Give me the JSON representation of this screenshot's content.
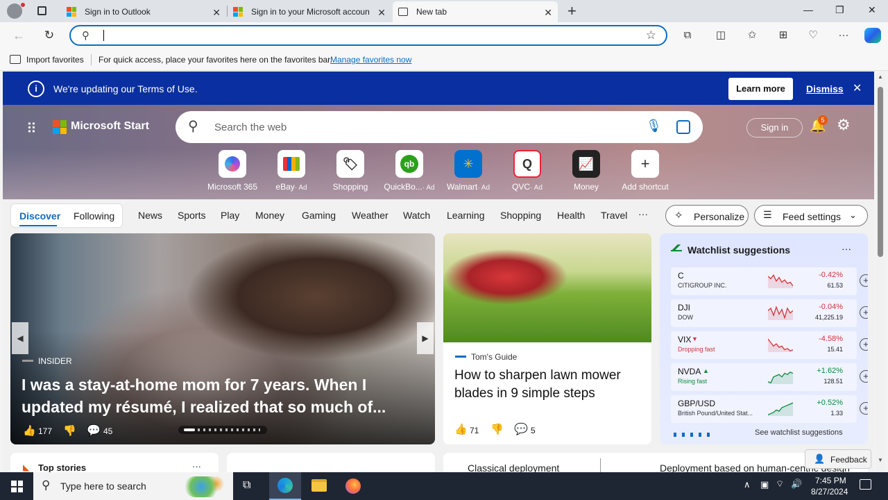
{
  "browser": {
    "tabs": [
      {
        "title": "Sign in to Outlook"
      },
      {
        "title": "Sign in to your Microsoft accoun"
      },
      {
        "title": "New tab"
      }
    ],
    "favorites_bar": {
      "import_label": "Import favorites",
      "hint": "For quick access, place your favorites here on the favorites bar.",
      "manage_link": "Manage favorites now"
    }
  },
  "banner": {
    "message": "We're updating our Terms of Use.",
    "learn_more": "Learn more",
    "dismiss": "Dismiss"
  },
  "header": {
    "brand": "Microsoft Start",
    "search_placeholder": "Search the web",
    "sign_in": "Sign in",
    "notification_count": "5"
  },
  "shortcuts": [
    {
      "label": "Microsoft 365",
      "ad": ""
    },
    {
      "label": "eBay",
      "ad": "· Ad"
    },
    {
      "label": "Shopping",
      "ad": ""
    },
    {
      "label": "QuickBo...",
      "ad": "· Ad"
    },
    {
      "label": "Walmart",
      "ad": "· Ad"
    },
    {
      "label": "QVC",
      "ad": "· Ad"
    },
    {
      "label": "Money",
      "ad": ""
    },
    {
      "label": "Add shortcut",
      "ad": ""
    }
  ],
  "nav": {
    "discover": "Discover",
    "following": "Following",
    "items": [
      "News",
      "Sports",
      "Play",
      "Money",
      "Gaming",
      "Weather",
      "Watch",
      "Learning",
      "Shopping",
      "Health",
      "Travel"
    ],
    "more": "···",
    "personalize": "Personalize",
    "feed_settings": "Feed settings"
  },
  "hero_article": {
    "source": "INSIDER",
    "title": "I was a stay-at-home mom for 7 years. When I updated my résumé, I realized that so much of...",
    "likes": "177",
    "comments": "45"
  },
  "side_article": {
    "source": "Tom's Guide",
    "title": "How to sharpen lawn mower blades in 9 simple steps",
    "likes": "71",
    "comments": "5"
  },
  "watchlist": {
    "title": "Watchlist suggestions",
    "more": "···",
    "items": [
      {
        "symbol": "C",
        "name": "CITIGROUP INC.",
        "change": "-0.42%",
        "price": "61.53",
        "dir": "down",
        "trend": [
          4,
          6,
          3,
          8,
          5,
          9,
          7,
          10,
          9,
          12
        ]
      },
      {
        "symbol": "DJI",
        "name": "DOW",
        "change": "-0.04%",
        "price": "41,225.19",
        "dir": "down",
        "trend": [
          6,
          4,
          10,
          3,
          9,
          5,
          12,
          4,
          8,
          6
        ]
      },
      {
        "symbol": "VIX",
        "name": "Dropping fast",
        "change": "-4.58%",
        "price": "15.41",
        "dir": "down",
        "trend": [
          3,
          6,
          9,
          7,
          10,
          9,
          12,
          11,
          13,
          12
        ]
      },
      {
        "symbol": "NVDA",
        "name": "Rising fast",
        "change": "+1.62%",
        "price": "128.51",
        "dir": "up",
        "trend": [
          12,
          13,
          8,
          7,
          6,
          8,
          5,
          6,
          4,
          5
        ]
      },
      {
        "symbol": "GBP/USD",
        "name": "British Pound/United Stat...",
        "change": "+0.52%",
        "price": "1.33",
        "dir": "up",
        "trend": [
          13,
          12,
          11,
          9,
          10,
          7,
          6,
          5,
          4,
          3
        ]
      }
    ],
    "see_all": "See watchlist suggestions"
  },
  "bottom_cards": {
    "top_stories": "Top stories",
    "classical": "Classical deployment",
    "deployment": "Deployment based on human-centric design"
  },
  "feedback": "Feedback",
  "taskbar": {
    "search_placeholder": "Type here to search",
    "time": "7:45 PM",
    "date": "8/27/2024"
  },
  "colors": {
    "accent": "#0f6cbd",
    "banner": "#0a2fa0",
    "up": "#0a8a3a",
    "down": "#d13438"
  }
}
